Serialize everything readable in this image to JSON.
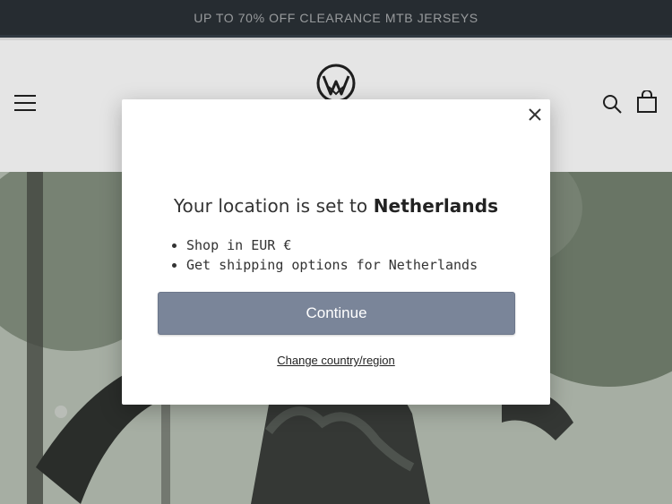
{
  "announcement": {
    "text": "UP TO 70% OFF CLEARANCE MTB JERSEYS"
  },
  "header": {
    "menu_icon": "hamburger-menu-icon",
    "logo_icon": "brand-logo-icon",
    "search_icon": "search-icon",
    "cart_icon": "cart-icon"
  },
  "modal": {
    "title_prefix": "Your location is set to ",
    "country": "Netherlands",
    "bullets": [
      "Shop in EUR €",
      "Get shipping options for Netherlands"
    ],
    "continue_label": "Continue",
    "change_link": "Change country/region",
    "close_icon": "close-icon"
  },
  "colors": {
    "announcement_bg": "#262c31",
    "button_bg": "#7a8599"
  }
}
